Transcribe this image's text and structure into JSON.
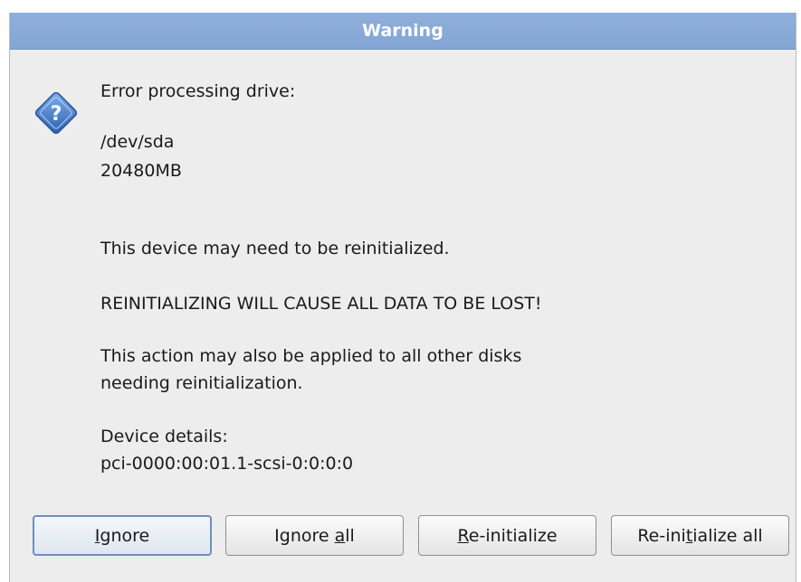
{
  "dialog": {
    "title": "Warning",
    "heading": "Error processing drive:",
    "device_path": "/dev/sda",
    "device_size": "20480MB",
    "line_reinit": "This device may need to be reinitialized.",
    "line_warning": "REINITIALIZING WILL CAUSE ALL DATA TO BE LOST!",
    "line_apply_1": "This action may also be applied to all other disks",
    "line_apply_2": "needing reinitialization.",
    "details_label": "Device details:",
    "details_value": "pci-0000:00:01.1-scsi-0:0:0:0",
    "icon": "question-icon"
  },
  "buttons": {
    "ignore": {
      "pre": "",
      "mnemonic": "I",
      "post": "gnore"
    },
    "ignore_all": {
      "pre": "Ignore ",
      "mnemonic": "a",
      "post": "ll"
    },
    "reinit": {
      "pre": "",
      "mnemonic": "R",
      "post": "e-initialize"
    },
    "reinit_all": {
      "pre": "Re-ini",
      "mnemonic": "t",
      "post": "ialize all"
    }
  },
  "colors": {
    "titlebar": "#8fb0da",
    "background": "#ededed",
    "icon": "#3f78c9"
  }
}
